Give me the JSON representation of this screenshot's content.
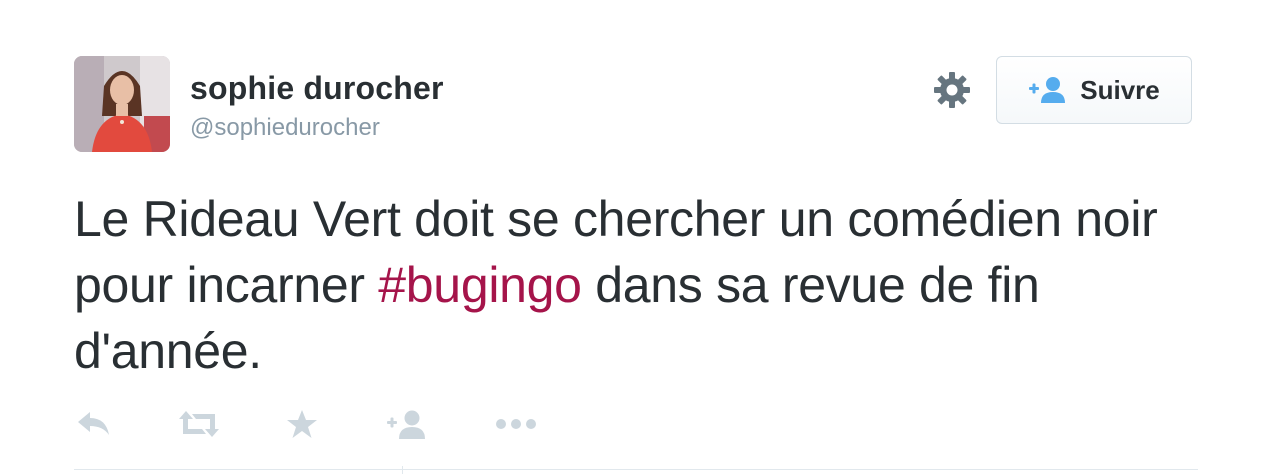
{
  "author": {
    "name": "sophie durocher",
    "handle": "@sophiedurocher",
    "avatar_icon": "profile-photo"
  },
  "header": {
    "settings_icon": "gear-icon",
    "follow_button": {
      "label": "Suivre",
      "icon": "follow-user-plus-icon"
    }
  },
  "tweet": {
    "text_before": "Le Rideau Vert doit se chercher un comédien noir pour incarner ",
    "hashtag": "#bugingo",
    "text_after": " dans sa revue de fin d'année."
  },
  "actions": [
    {
      "name": "reply",
      "icon": "reply-icon"
    },
    {
      "name": "retweet",
      "icon": "retweet-icon"
    },
    {
      "name": "favorite",
      "icon": "star-icon"
    },
    {
      "name": "follow",
      "icon": "follow-user-plus-icon"
    },
    {
      "name": "more",
      "icon": "more-dots-icon"
    }
  ],
  "colors": {
    "text": "#292f33",
    "muted": "#8899a6",
    "hashtag": "#a5144a",
    "icon_gray": "#ccd6dd",
    "gear": "#66757f",
    "follow_accent": "#55acee"
  }
}
